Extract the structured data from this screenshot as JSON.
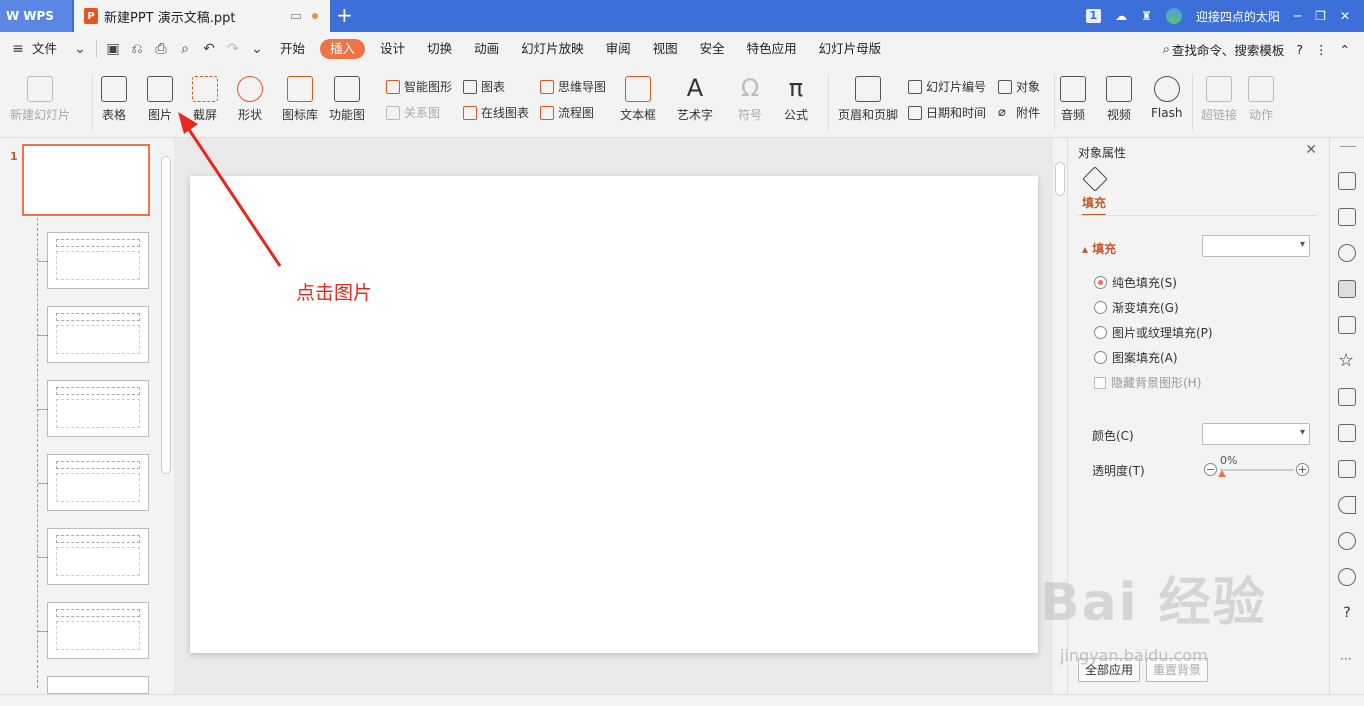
{
  "titlebar": {
    "app_name": "WPS",
    "doc_tab": "新建PPT 演示文稿.ppt",
    "new_tab": "+",
    "badge": "1",
    "user_name": "迎接四点的太阳"
  },
  "menubar": {
    "file_label": "文件",
    "tabs": [
      "开始",
      "插入",
      "设计",
      "切换",
      "动画",
      "幻灯片放映",
      "审阅",
      "视图",
      "安全",
      "特色应用",
      "幻灯片母版"
    ],
    "active_tab": "插入",
    "search_label": "查找命令、搜索模板"
  },
  "ribbon": {
    "new_slide": "新建幻灯片",
    "table": "表格",
    "picture": "图片",
    "screenshot": "截屏",
    "shape": "形状",
    "icon_lib": "图标库",
    "function_diagram": "功能图",
    "smart_shape": "智能图形",
    "relation_diagram": "关系图",
    "chart": "图表",
    "online_chart": "在线图表",
    "mind_map": "思维导图",
    "flowchart": "流程图",
    "textbox": "文本框",
    "wordart": "艺术字",
    "symbol": "符号",
    "formula": "公式",
    "header_footer": "页眉和页脚",
    "slide_number": "幻灯片编号",
    "date_time": "日期和时间",
    "object": "对象",
    "attachment": "附件",
    "audio": "音频",
    "video": "视频",
    "flash": "Flash",
    "hyperlink": "超链接",
    "action": "动作"
  },
  "thumbs": {
    "slide_number": "1"
  },
  "annotation": {
    "text": "点击图片",
    "color": "#e8281c"
  },
  "props": {
    "title": "对象属性",
    "tab_fill": "填充",
    "section_fill": "填充",
    "options": [
      "纯色填充(S)",
      "渐变填充(G)",
      "图片或纹理填充(P)",
      "图案填充(A)"
    ],
    "selected_option": "纯色填充(S)",
    "hide_bg": "隐藏背景图形(H)",
    "color_label": "颜色(C)",
    "transparency_label": "透明度(T)",
    "transparency_value": "0%",
    "apply_all": "全部应用",
    "reset_bg": "重置背景"
  },
  "watermark": {
    "brand": "Bai 经验",
    "url": "jingyan.baidu.com"
  },
  "colors": {
    "accent": "#ec7446",
    "titlebar": "#3d6fd8"
  }
}
